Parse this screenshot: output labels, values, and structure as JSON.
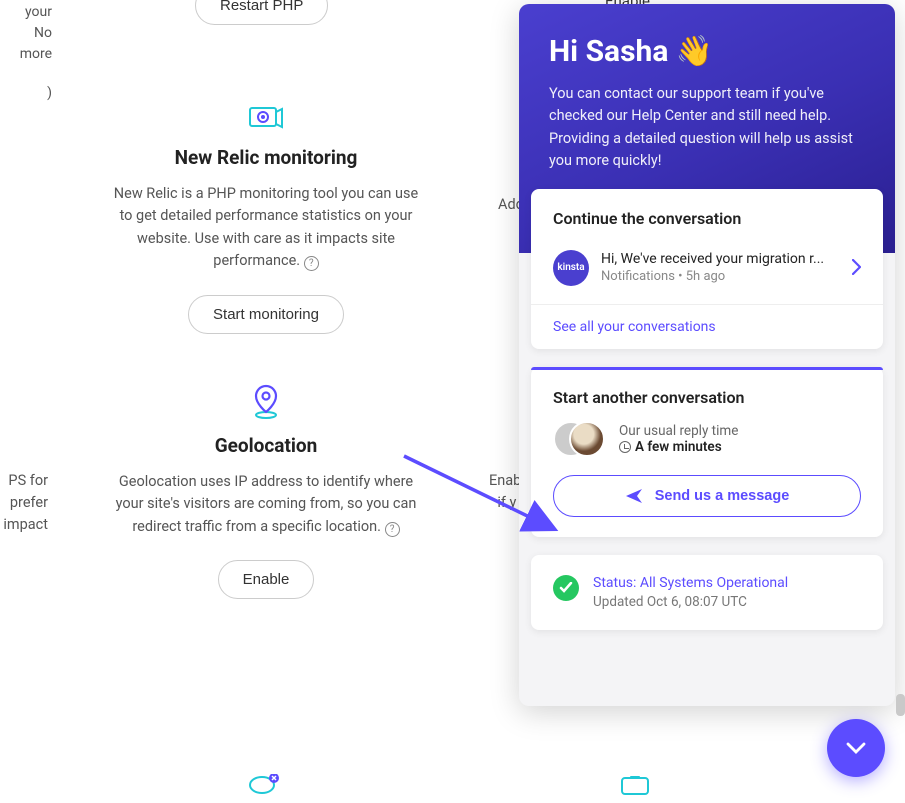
{
  "top_row": {
    "restart_btn": "Restart PHP",
    "enable_btn": "Enable",
    "left_frag": [
      "your",
      "No more",
      "",
      ")"
    ]
  },
  "new_relic": {
    "title": "New Relic monitoring",
    "desc": "New Relic is a PHP monitoring tool you can use to get detailed performance statistics on your website. Use with care as it impacts site performance.",
    "btn": "Start monitoring",
    "right_frag": "Add"
  },
  "geo": {
    "title": "Geolocation",
    "desc": "Geolocation uses IP address to identify where your site's visitors are coming from, so you can redirect traffic from a specific location.",
    "btn": "Enable",
    "left_frag": [
      "PS for",
      "prefer",
      "impact"
    ],
    "right_frag": [
      "Enabl",
      "if y"
    ]
  },
  "chat": {
    "greeting": "Hi Sasha 👋",
    "intro": "You can contact our support team if you've checked our Help Center and still need help. Providing a detailed question will help us assist you more quickly!",
    "continue_title": "Continue the conversation",
    "conv_msg": "Hi, We've received your migration r...",
    "conv_from": "Notifications",
    "conv_time": "5h ago",
    "avatar_label": "kinsta",
    "see_all": "See all your conversations",
    "start_title": "Start another conversation",
    "reply_label": "Our usual reply time",
    "reply_value": "A few minutes",
    "send_btn": "Send us a message",
    "status_text": "Status: All Systems Operational",
    "status_updated": "Updated Oct 6, 08:07 UTC"
  }
}
